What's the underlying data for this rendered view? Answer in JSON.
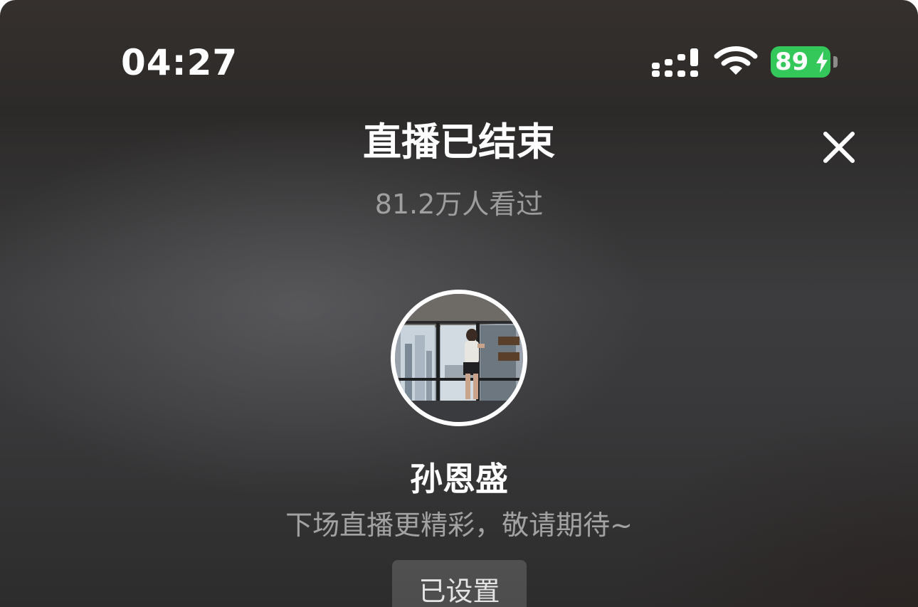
{
  "status_bar": {
    "time": "04:27",
    "battery_level": "89",
    "icons": [
      "signal-icon",
      "wifi-icon",
      "battery-charging-icon"
    ]
  },
  "header": {
    "title": "直播已结束",
    "viewers": "81.2万人看过",
    "close_icon": "close-icon"
  },
  "anchor": {
    "name": "孙恩盛",
    "tagline": "下场直播更精彩，敬请期待~",
    "reminder_button": "已设置"
  },
  "colors": {
    "battery": "#34c759",
    "background": "#3a3a3c"
  }
}
